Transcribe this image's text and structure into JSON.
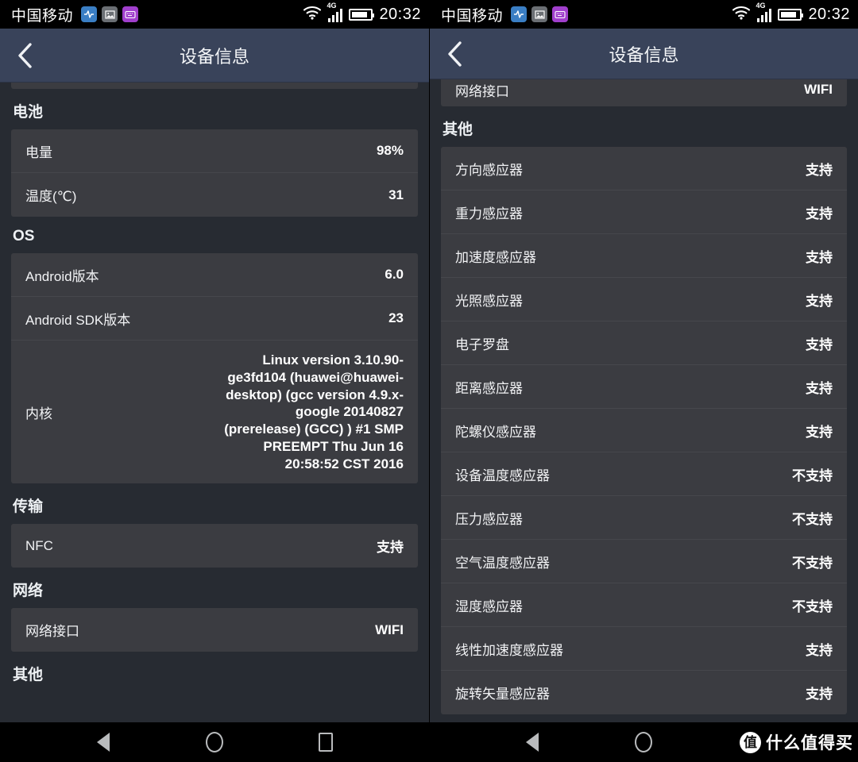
{
  "status_bar": {
    "carrier": "中国移动",
    "clock": "20:32",
    "network_type": "4G",
    "icons": [
      "pulse-badge-icon",
      "image-badge-icon",
      "keyboard-badge-icon",
      "wifi-icon",
      "signal-bars-icon",
      "battery-icon"
    ]
  },
  "app_bar": {
    "title": "设备信息",
    "back_label": "‹"
  },
  "left_screen": {
    "clipped_top_row": {
      "key": "",
      "value": ""
    },
    "sections": [
      {
        "title": "电池",
        "rows": [
          {
            "key": "电量",
            "value": "98%"
          },
          {
            "key": "温度(℃)",
            "value": "31"
          }
        ]
      },
      {
        "title": "OS",
        "rows": [
          {
            "key": "Android版本",
            "value": "6.0"
          },
          {
            "key": "Android SDK版本",
            "value": "23"
          },
          {
            "key": "内核",
            "value": "Linux version 3.10.90-ge3fd104 (huawei@huawei-desktop) (gcc version 4.9.x-google 20140827 (prerelease) (GCC) ) #1 SMP PREEMPT Thu Jun 16 20:58:52 CST 2016",
            "tall": true
          }
        ]
      },
      {
        "title": "传输",
        "rows": [
          {
            "key": "NFC",
            "value": "支持"
          }
        ]
      },
      {
        "title": "网络",
        "rows": [
          {
            "key": "网络接口",
            "value": "WIFI"
          }
        ]
      }
    ],
    "cut_off_title": "其他"
  },
  "right_screen": {
    "clipped_top_row": {
      "key": "网络接口",
      "value": "WIFI"
    },
    "sections": [
      {
        "title": "其他",
        "rows": [
          {
            "key": "方向感应器",
            "value": "支持"
          },
          {
            "key": "重力感应器",
            "value": "支持"
          },
          {
            "key": "加速度感应器",
            "value": "支持"
          },
          {
            "key": "光照感应器",
            "value": "支持"
          },
          {
            "key": "电子罗盘",
            "value": "支持"
          },
          {
            "key": "距离感应器",
            "value": "支持"
          },
          {
            "key": "陀螺仪感应器",
            "value": "支持"
          },
          {
            "key": "设备温度感应器",
            "value": "不支持"
          },
          {
            "key": "压力感应器",
            "value": "不支持"
          },
          {
            "key": "空气温度感应器",
            "value": "不支持"
          },
          {
            "key": "湿度感应器",
            "value": "不支持"
          },
          {
            "key": "线性加速度感应器",
            "value": "支持"
          },
          {
            "key": "旋转矢量感应器",
            "value": "支持"
          }
        ]
      }
    ]
  },
  "nav_bar": {
    "buttons": [
      "back-triangle-icon",
      "home-circle-icon",
      "recents-square-icon"
    ],
    "watermark_logo": "值",
    "watermark_text": "什么值得买"
  },
  "colors": {
    "page_bg": "#272b32",
    "card_bg": "#3b3c41",
    "appbar_bg": "#39435a",
    "status_bg": "#000000",
    "text_primary": "#f2f3f5"
  }
}
